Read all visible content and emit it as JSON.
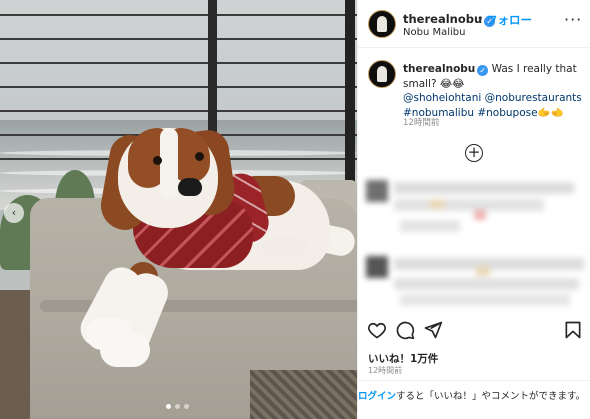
{
  "post": {
    "image_alt": "Brown and white dog wearing a red knit sweater lying on an outdoor cushion by the ocean",
    "carousel": {
      "total": 3,
      "active_index": 0
    }
  },
  "header": {
    "username": "therealnobu",
    "separator": "•",
    "follow_label": "フォロー",
    "location": "Nobu Malibu",
    "more_label": "···"
  },
  "caption": {
    "username": "therealnobu",
    "text": "Was I really that small? 😂😂",
    "mentions": [
      "@shoheiohtani",
      "@noburestaurants"
    ],
    "hashtags": [
      "#nobumalibu",
      "#nobupose",
      "🫱🫲"
    ],
    "time": "12時間前"
  },
  "load_more_icon": "plus-circle-icon",
  "actions": {
    "like_icon": "heart-icon",
    "comment_icon": "comment-icon",
    "share_icon": "send-icon",
    "save_icon": "bookmark-icon"
  },
  "likes_label": "いいね！1万件",
  "post_time": "12時間前",
  "login": {
    "link_label": "ログイン",
    "rest": "すると「いいね！」やコメントができます。"
  },
  "colors": {
    "link_blue": "#0095f6",
    "tag_blue": "#00376b",
    "verified_blue": "#3897f0",
    "muted": "#8e8e8e"
  }
}
